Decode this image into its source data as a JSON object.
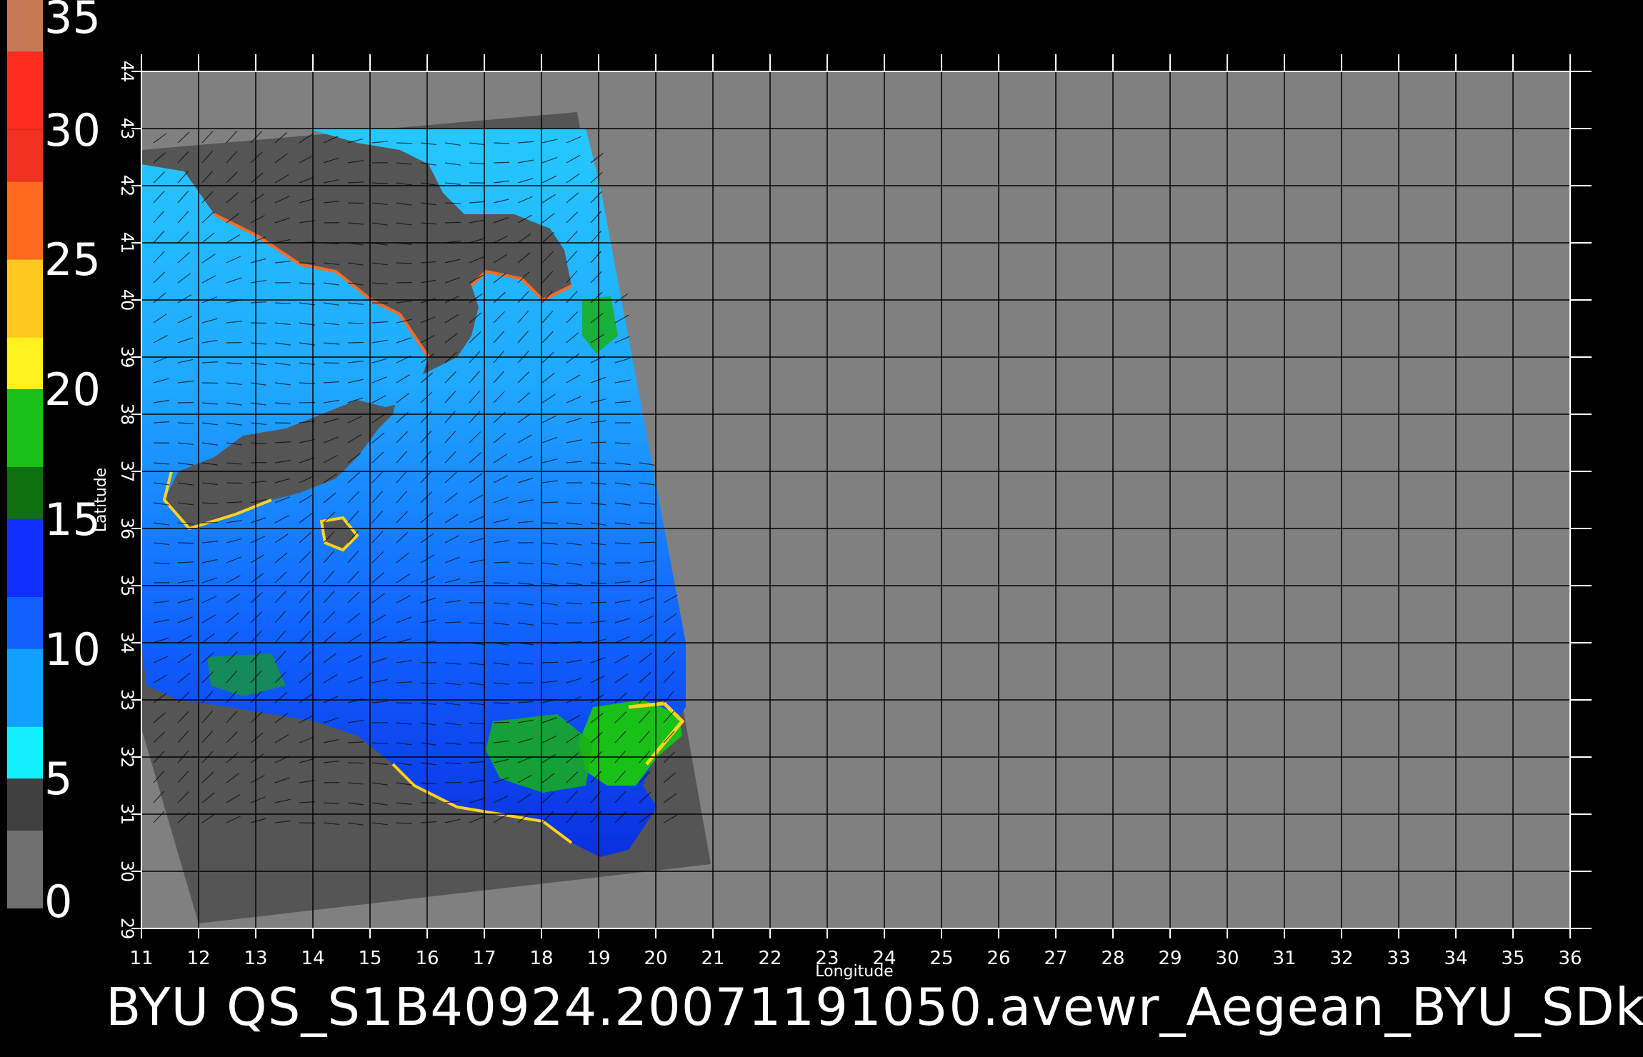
{
  "colorbar": {
    "labels": [
      "35",
      "30",
      "25",
      "20",
      "15",
      "10",
      "5",
      "0"
    ],
    "values": [
      35,
      30,
      25,
      20,
      15,
      10,
      5,
      0
    ],
    "colors": [
      "#c77a55",
      "#ff2a1e",
      "#ff6a1e",
      "#ffd21e",
      "#18c018",
      "#1040ff",
      "#10d8ff",
      "#707070"
    ]
  },
  "map": {
    "x_axis_label": "Longitude",
    "y_axis_label": "Latitude",
    "lon_ticks": [
      "11",
      "12",
      "13",
      "14",
      "15",
      "16",
      "17",
      "18",
      "19",
      "20",
      "21",
      "22",
      "23",
      "24",
      "25",
      "26",
      "27",
      "28",
      "29",
      "30",
      "31",
      "32",
      "33",
      "34",
      "35",
      "36"
    ],
    "lat_ticks": [
      "29",
      "30",
      "31",
      "32",
      "33",
      "34",
      "35",
      "36",
      "37",
      "38",
      "39",
      "40",
      "41",
      "42",
      "43",
      "44"
    ],
    "lon_range": [
      11,
      36
    ],
    "lat_range": [
      29,
      44
    ],
    "grid": true,
    "background_color": "#808080",
    "swath_color": "#555555"
  },
  "caption": "BYU  QS_S1B40924.20071191050.avewr_Aegean_BYU_SDk"
}
